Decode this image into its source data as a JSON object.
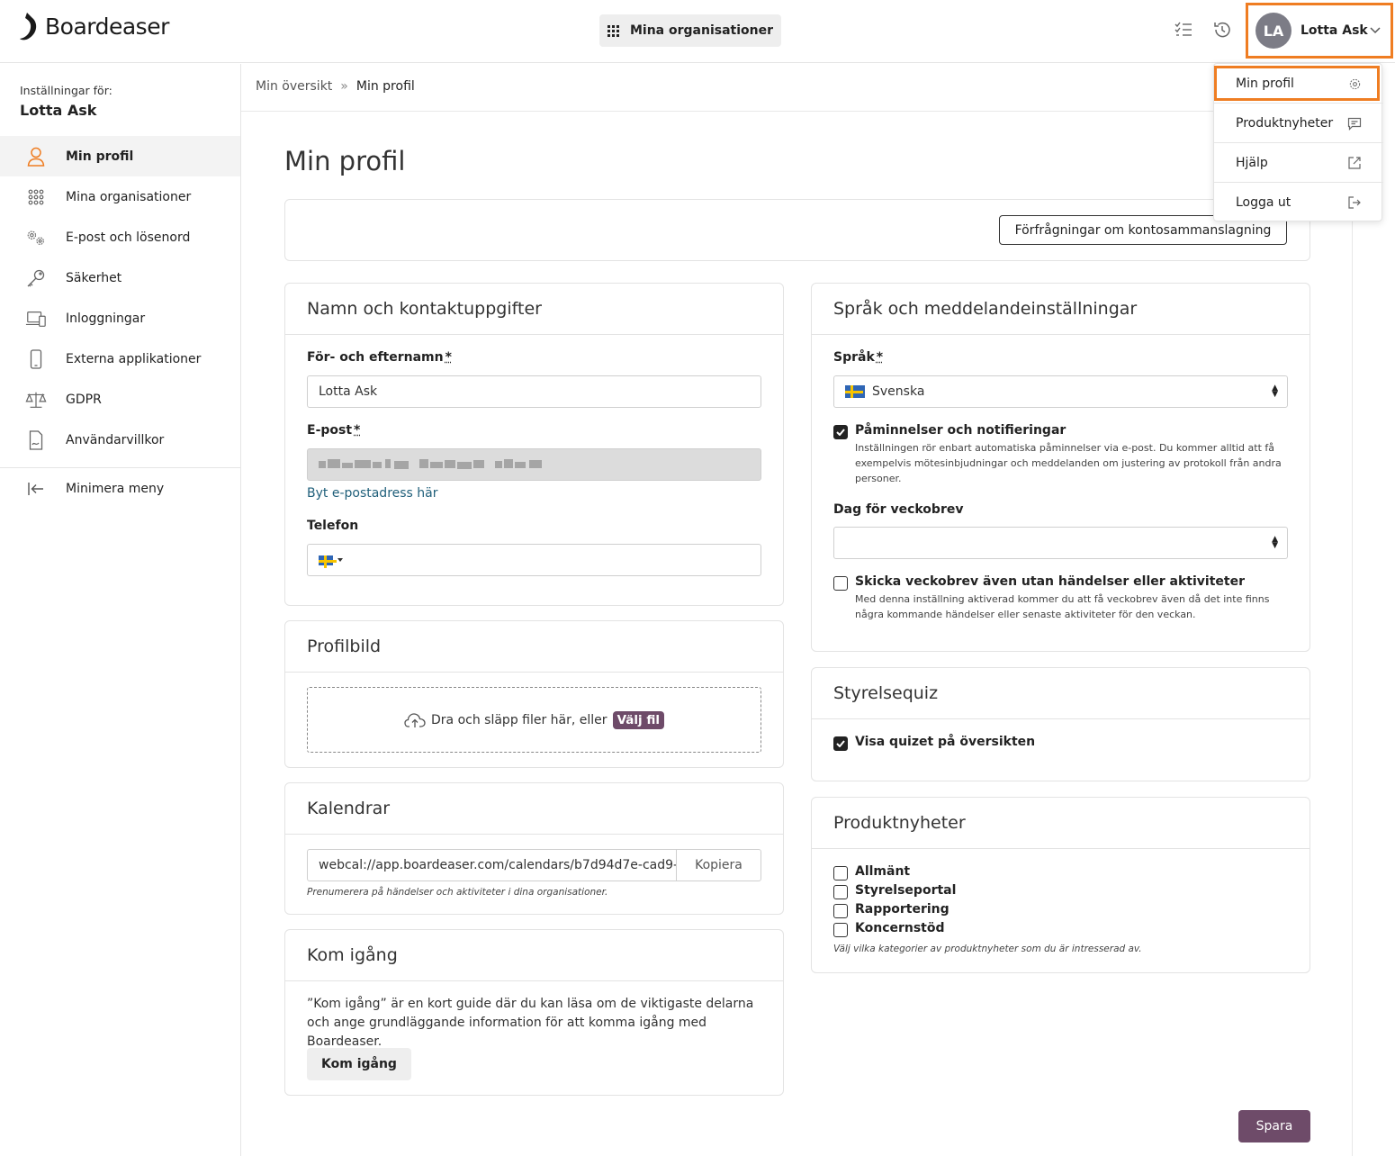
{
  "colors": {
    "accent": "#ef7d22",
    "primary": "#6e4b69",
    "link": "#1f5f7a"
  },
  "header": {
    "logo_text": "Boardeaser",
    "orgs_button": "Mina organisationer",
    "user_initials": "LA",
    "user_name": "Lotta Ask"
  },
  "dropdown": {
    "items": [
      {
        "label": "Min profil",
        "icon": "gear-icon"
      },
      {
        "label": "Produktnyheter",
        "icon": "chat-icon"
      },
      {
        "label": "Hjälp",
        "icon": "external-link-icon"
      },
      {
        "label": "Logga ut",
        "icon": "logout-icon"
      }
    ]
  },
  "sidebar": {
    "settings_for": "Inställningar för:",
    "user_name": "Lotta Ask",
    "items": [
      {
        "label": "Min profil",
        "icon": "user-icon"
      },
      {
        "label": "Mina organisationer",
        "icon": "grid-icon"
      },
      {
        "label": "E-post och lösenord",
        "icon": "gears-icon"
      },
      {
        "label": "Säkerhet",
        "icon": "key-icon"
      },
      {
        "label": "Inloggningar",
        "icon": "devices-icon"
      },
      {
        "label": "Externa applikationer",
        "icon": "phone-icon"
      },
      {
        "label": "GDPR",
        "icon": "scales-icon"
      },
      {
        "label": "Användarvillkor",
        "icon": "document-icon"
      }
    ],
    "minimize": "Minimera meny"
  },
  "breadcrumb": {
    "home": "Min översikt",
    "separator": "»",
    "current": "Min profil"
  },
  "page_title": "Min profil",
  "merge_button": "Förfrågningar om kontosammanslagning",
  "contact": {
    "title": "Namn och kontaktuppgifter",
    "name_label": "För- och efternamn",
    "name_value": "Lotta Ask",
    "email_label": "E-post",
    "change_email_link": "Byt e-postadress här",
    "phone_label": "Telefon",
    "required_mark": "*"
  },
  "profile_picture": {
    "title": "Profilbild",
    "drop_text": "Dra och släpp filer här, eller",
    "choose_file": "Välj fil"
  },
  "calendars": {
    "title": "Kalendrar",
    "url": "webcal://app.boardeaser.com/calendars/b7d94d7e-cad9-",
    "copy": "Kopiera",
    "help": "Prenumerera på händelser och aktiviteter i dina organisationer."
  },
  "get_started": {
    "title": "Kom igång",
    "text": "”Kom igång” är en kort guide där du kan läsa om de viktigaste delarna och ange grundläggande information för att komma igång med Boardeaser.",
    "button": "Kom igång"
  },
  "language": {
    "title": "Språk och meddelandeinställningar",
    "language_label": "Språk",
    "language_value": "Svenska",
    "reminders_label": "Påminnelser och notifieringar",
    "reminders_checked": true,
    "reminders_desc": "Inställningen rör enbart automatiska påminnelser via e-post. Du kommer alltid att få exempelvis mötesinbjudningar och meddelanden om justering av protokoll från andra personer.",
    "weekly_label": "Dag för veckobrev",
    "weekly_value": "",
    "weekly_empty_label": "Skicka veckobrev även utan händelser eller aktiviteter",
    "weekly_empty_checked": false,
    "weekly_empty_desc": "Med denna inställning aktiverad kommer du att få veckobrev även då det inte finns några kommande händelser eller senaste aktiviteter för den veckan."
  },
  "quiz": {
    "title": "Styrelsequiz",
    "show_label": "Visa quizet på översikten",
    "show_checked": true
  },
  "news": {
    "title": "Produktnyheter",
    "options": [
      {
        "label": "Allmänt",
        "checked": false
      },
      {
        "label": "Styrelseportal",
        "checked": false
      },
      {
        "label": "Rapportering",
        "checked": false
      },
      {
        "label": "Koncernstöd",
        "checked": false
      }
    ],
    "help": "Välj vilka kategorier av produktnyheter som du är intresserad av."
  },
  "save_button": "Spara"
}
